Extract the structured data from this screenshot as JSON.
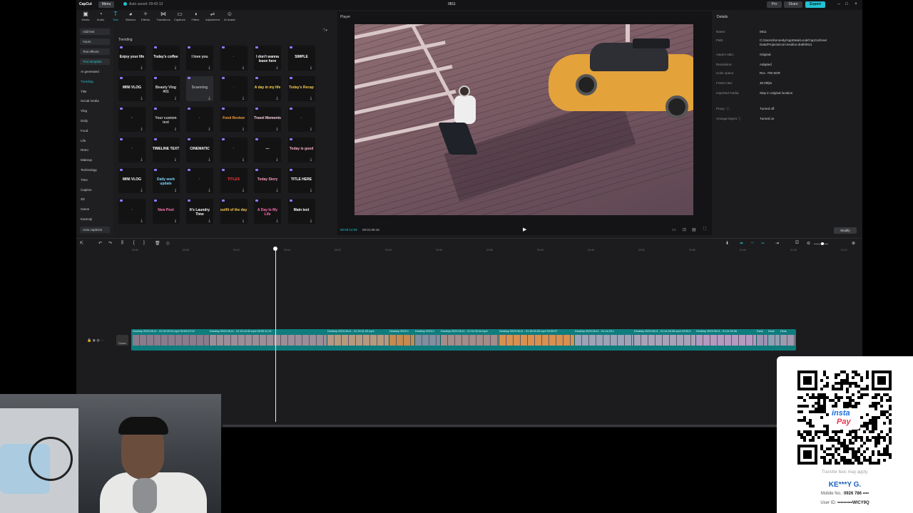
{
  "titlebar": {
    "logo": "CapCut",
    "menu": "Menu",
    "autosave": "Auto saved: 09:42:13",
    "project_title": "0811",
    "pro": "Pro",
    "share": "Share",
    "export": "Export",
    "win_min": "–",
    "win_max": "□",
    "win_close": "×"
  },
  "tools": [
    {
      "label": "Media",
      "icon": "media-icon",
      "glyph": "▣"
    },
    {
      "label": "Audio",
      "icon": "audio-icon",
      "glyph": "◔"
    },
    {
      "label": "Text",
      "icon": "text-icon",
      "glyph": "T"
    },
    {
      "label": "Stickers",
      "icon": "sticker-icon",
      "glyph": "◕"
    },
    {
      "label": "Effects",
      "icon": "effects-icon",
      "glyph": "✧"
    },
    {
      "label": "Transitions",
      "icon": "transitions-icon",
      "glyph": "⋈"
    },
    {
      "label": "Captions",
      "icon": "captions-icon",
      "glyph": "▭"
    },
    {
      "label": "Filters",
      "icon": "filters-icon",
      "glyph": "◑"
    },
    {
      "label": "Adjustment",
      "icon": "adjustment-icon",
      "glyph": "⇌"
    },
    {
      "label": "AI avatar",
      "icon": "avatar-icon",
      "glyph": "☺"
    }
  ],
  "categories": {
    "add_text": "Add text",
    "yours": "Yours",
    "text_effects": "Text effects",
    "text_template": "Text template",
    "items": [
      "AI generated",
      "Trending",
      "Title",
      "Social media",
      "Vlog",
      "Daily",
      "Food",
      "Life",
      "Retro",
      "Makeup",
      "Technology",
      "Time",
      "Caption",
      "3D",
      "Game",
      "Kaomoji"
    ],
    "auto_captions": "Auto captions"
  },
  "grid": {
    "section": "Trending",
    "filter_icon": "⊤▾",
    "thumbs": [
      "Enjoy your life",
      "Today's coffee",
      "I love you",
      "·",
      "I don't wanna leave here",
      "SIMPLE",
      "MINI VLOG",
      "Beauty Vlog #01",
      "Scanning",
      "·",
      "A day in my life",
      "Today's Recap",
      "·",
      "Your custom text",
      "·",
      "Food Review",
      "Travel Moments",
      "·",
      "·",
      "TIMELINE TEXT",
      "CINEMATIC",
      "·",
      "—",
      "Today is good",
      "MINI VLOG",
      "Daily work update",
      "·",
      "TITLES",
      "Today Story",
      "TITLE HERE",
      "·",
      "New Post",
      "It's Laundry Time",
      "outfit of the day",
      "A Day In My Life",
      "Main text"
    ]
  },
  "player": {
    "label": "Player",
    "time_current": "00:00:14:09",
    "time_total": "00:01:06:18",
    "play_icon": "▶"
  },
  "details": {
    "title": "Details",
    "rows": [
      {
        "k": "Name:",
        "v": "0811"
      },
      {
        "k": "Path:",
        "v": "C:/Users/Kennedy/AppData/Local/CapCut/User Data/Projects/com.lveditor.draft/0811"
      },
      {
        "k": "Aspect ratio:",
        "v": "Original"
      },
      {
        "k": "Resolution:",
        "v": "Adapted"
      },
      {
        "k": "Color space:",
        "v": "Rec. 709 SDR"
      },
      {
        "k": "Frame rate:",
        "v": "30.00fps"
      },
      {
        "k": "Imported media:",
        "v": "Stay in original location"
      },
      {
        "k": "Proxy: ⓘ",
        "v": "Turned off"
      },
      {
        "k": "Arrange layers ⓘ",
        "v": "Turned on"
      }
    ],
    "modify": "Modify"
  },
  "timeline": {
    "ruler": [
      "00:00",
      "00:05",
      "00:10",
      "00:15",
      "00:20",
      "00:25",
      "00:30",
      "00:35",
      "00:40",
      "00:45",
      "00:50",
      "00:55",
      "01:00",
      "01:05",
      "01:10"
    ],
    "clips": [
      "Desktop 2023.08.11 - 01.09.29.01.mp4  00:00:07:02",
      "Desktop 2023.08.11 - 01.15.44.02.mp4  00:00:11:13",
      "Desktop 2023.08.11 - 01.25.01.03.mp4",
      "Desktop 2023.0",
      "Desktop 2023.0",
      "Desktop 2023.08.11 - 01.34.09.04.mp4",
      "Desktop 2023.08.11 - 01.38.33.05.mp4  00:00:07",
      "Desktop 2023.08.11 - 01.44.33.1",
      "Desktop 2023.08.11 - 01.44.33.06.mp4  00:00:0",
      "Desktop 2023.08.11 - 01.44.33.06",
      "Desk",
      "Desk",
      "Desk"
    ],
    "cover": "Cover"
  },
  "qr": {
    "brand_top": "insta",
    "brand_bottom": "Pay",
    "fees": "Transfer fees may apply.",
    "name": "KE***Y G.",
    "mobile_label": "Mobile No.:",
    "mobile": "0926 786 ••••",
    "uid_label": "User ID:",
    "uid": "••••••••••WICY9Q"
  }
}
